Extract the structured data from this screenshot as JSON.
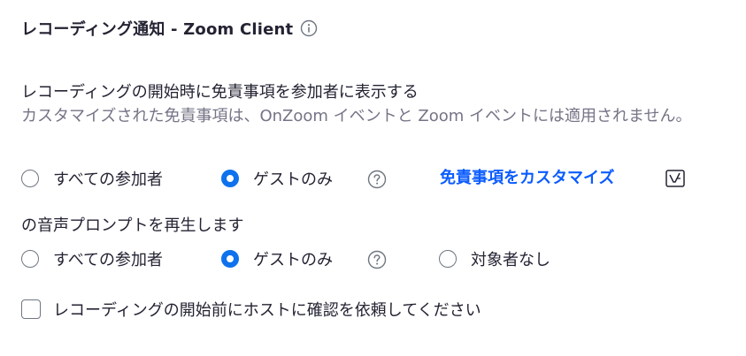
{
  "header": {
    "title": "レコーディング通知 - Zoom Client",
    "info_icon": "info-circle-icon"
  },
  "disclaimer": {
    "label": "レコーディングの開始時に免責事項を参加者に表示する",
    "description": "カスタマイズされた免責事項は、OnZoom イベントと Zoom イベントには適用されません。",
    "options": [
      {
        "label": "すべての参加者",
        "selected": false
      },
      {
        "label": "ゲストのみ",
        "selected": true
      }
    ],
    "help_icon": "question-circle-icon",
    "customize_link": "免責事項をカスタマイズ",
    "customize_icon": "edit-icon"
  },
  "voice_prompt": {
    "label": "の音声プロンプトを再生します",
    "options": [
      {
        "label": "すべての参加者",
        "selected": false
      },
      {
        "label": "ゲストのみ",
        "selected": true
      },
      {
        "label": "対象者なし",
        "selected": false
      }
    ],
    "help_icon": "question-circle-icon"
  },
  "host_confirm": {
    "label": "レコーディングの開始前にホストに確認を依頼してください",
    "checked": false
  },
  "colors": {
    "accent": "#0e72ed",
    "link": "#0b5cff",
    "text": "#232333",
    "muted": "#747487"
  }
}
